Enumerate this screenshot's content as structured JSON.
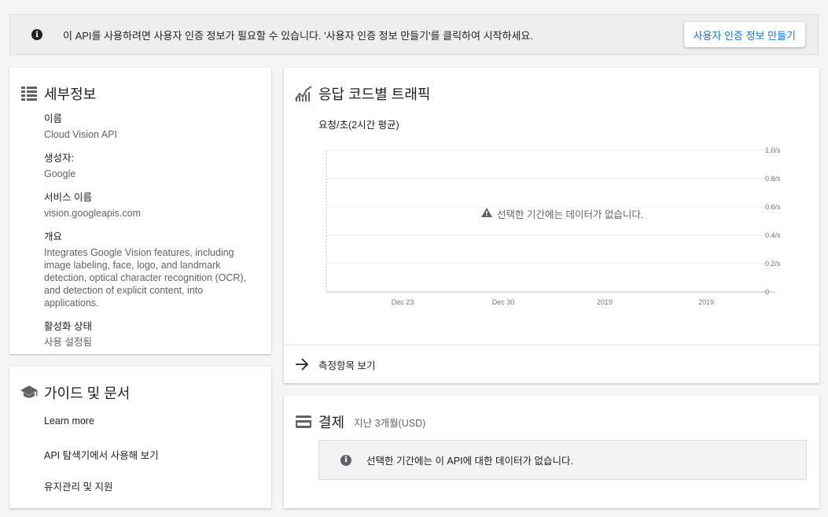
{
  "banner": {
    "message": "이 API를 사용하려면 사용자 인증 정보가 필요할 수 있습니다. '사용자 인증 정보 만들기'를 클릭하여 시작하세요.",
    "button_label": "사용자 인증 정보 만들기"
  },
  "details": {
    "title": "세부정보",
    "fields": [
      {
        "label": "이름",
        "value": "Cloud Vision API"
      },
      {
        "label": "생성자:",
        "value": "Google"
      },
      {
        "label": "서비스 이름",
        "value": "vision.googleapis.com"
      },
      {
        "label": "개요",
        "value": "Integrates Google Vision features, including image labeling, face, logo, and landmark detection, optical character recognition (OCR), and detection of explicit content, into applications."
      },
      {
        "label": "활성화 상태",
        "value": "사용 설정됨"
      }
    ]
  },
  "guide": {
    "title": "가이드 및 문서",
    "links": [
      "Learn more",
      "API 탐색기에서 사용해 보기",
      "유지관리 및 지원"
    ]
  },
  "traffic": {
    "title": "응답 코드별 트래픽",
    "subtitle": "요청/초(2시간 평균)",
    "no_data": "선택한 기간에는 데이터가 없습니다.",
    "footer_label": "측정항목 보기"
  },
  "billing": {
    "title": "결제",
    "period": "지난 3개월(USD)",
    "notice": "선택한 기간에는 이 API에 대한 데이터가 없습니다."
  },
  "chart_data": {
    "type": "line",
    "x": [
      "Dec 23",
      "Dec 30",
      "2019",
      "2019"
    ],
    "y_ticks": [
      "0",
      "0.2/s",
      "0.4/s",
      "0.6/s",
      "0.8/s",
      "1.0/s"
    ],
    "ylim": [
      0,
      1.0
    ],
    "series": [],
    "grid": true
  }
}
